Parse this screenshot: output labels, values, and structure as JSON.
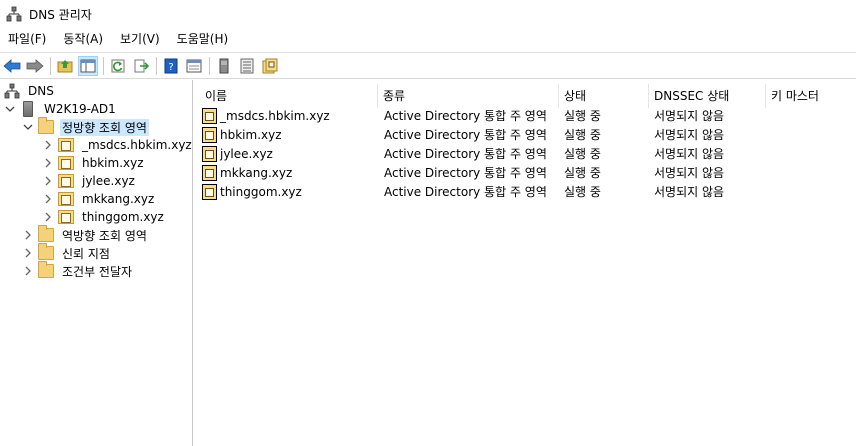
{
  "window": {
    "title": "DNS 관리자"
  },
  "menu": [
    "파일(F)",
    "동작(A)",
    "보기(V)",
    "도움말(H)"
  ],
  "toolbar_icons": [
    "back-arrow-icon",
    "forward-arrow-icon",
    "up-folder-icon",
    "show-hide-tree-icon",
    "refresh-icon",
    "export-list-icon",
    "help-icon",
    "properties-icon",
    "server-icon",
    "list-icon",
    "zone-icon"
  ],
  "tree": {
    "root": "DNS",
    "server": "W2K19-AD1",
    "forward_zones": "정방향 조회 영역",
    "zones": [
      "_msdcs.hbkim.xyz",
      "hbkim.xyz",
      "jylee.xyz",
      "mkkang.xyz",
      "thinggom.xyz"
    ],
    "reverse_zones": "역방향 조회 영역",
    "trust_points": "신뢰 지점",
    "conditional_forwarders": "조건부 전달자"
  },
  "list": {
    "headers": [
      "이름",
      "종류",
      "상태",
      "DNSSEC 상태",
      "키 마스터"
    ],
    "rows": [
      [
        "_msdcs.hbkim.xyz",
        "Active Directory 통합 주 영역",
        "실행 중",
        "서명되지 않음",
        ""
      ],
      [
        "hbkim.xyz",
        "Active Directory 통합 주 영역",
        "실행 중",
        "서명되지 않음",
        ""
      ],
      [
        "jylee.xyz",
        "Active Directory 통합 주 영역",
        "실행 중",
        "서명되지 않음",
        ""
      ],
      [
        "mkkang.xyz",
        "Active Directory 통합 주 영역",
        "실행 중",
        "서명되지 않음",
        ""
      ],
      [
        "thinggom.xyz",
        "Active Directory 통합 주 영역",
        "실행 중",
        "서명되지 않음",
        ""
      ]
    ]
  },
  "colors": {
    "selection": "#cce8ff",
    "folder": "#f4d27a"
  }
}
